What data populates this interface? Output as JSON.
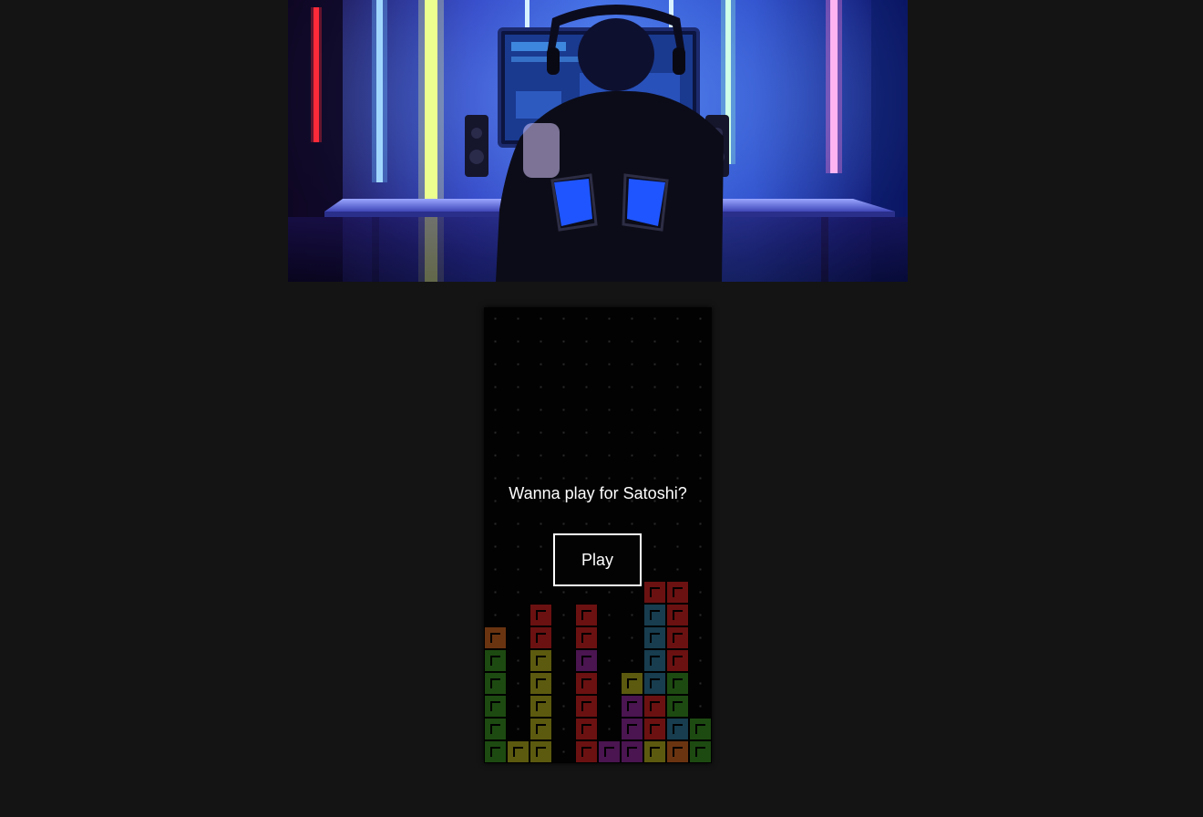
{
  "hero": {
    "image": "gamer-desk-neon-room"
  },
  "board": {
    "columns": 10,
    "rows": 20,
    "dot_color": "#2a2a2a",
    "background": "#020202",
    "stack": [
      {
        "col": 7,
        "row": 12,
        "color": "#6b1111"
      },
      {
        "col": 8,
        "row": 12,
        "color": "#6b1111"
      },
      {
        "col": 2,
        "row": 13,
        "color": "#6b1111"
      },
      {
        "col": 4,
        "row": 13,
        "color": "#6b1111"
      },
      {
        "col": 7,
        "row": 13,
        "color": "#173d4f"
      },
      {
        "col": 8,
        "row": 13,
        "color": "#6b1111"
      },
      {
        "col": 0,
        "row": 14,
        "color": "#6b3411"
      },
      {
        "col": 2,
        "row": 14,
        "color": "#6b1111"
      },
      {
        "col": 4,
        "row": 14,
        "color": "#6b1111"
      },
      {
        "col": 7,
        "row": 14,
        "color": "#173d4f"
      },
      {
        "col": 8,
        "row": 14,
        "color": "#6b1111"
      },
      {
        "col": 0,
        "row": 15,
        "color": "#1d4a11"
      },
      {
        "col": 2,
        "row": 15,
        "color": "#5c5a0f"
      },
      {
        "col": 4,
        "row": 15,
        "color": "#4a1550"
      },
      {
        "col": 7,
        "row": 15,
        "color": "#173d4f"
      },
      {
        "col": 8,
        "row": 15,
        "color": "#6b1111"
      },
      {
        "col": 0,
        "row": 16,
        "color": "#1d4a11"
      },
      {
        "col": 2,
        "row": 16,
        "color": "#5c5a0f"
      },
      {
        "col": 4,
        "row": 16,
        "color": "#6b1111"
      },
      {
        "col": 6,
        "row": 16,
        "color": "#5c5a0f"
      },
      {
        "col": 7,
        "row": 16,
        "color": "#173d4f"
      },
      {
        "col": 8,
        "row": 16,
        "color": "#1d4a11"
      },
      {
        "col": 0,
        "row": 17,
        "color": "#1d4a11"
      },
      {
        "col": 2,
        "row": 17,
        "color": "#5c5a0f"
      },
      {
        "col": 4,
        "row": 17,
        "color": "#6b1111"
      },
      {
        "col": 6,
        "row": 17,
        "color": "#4a1550"
      },
      {
        "col": 7,
        "row": 17,
        "color": "#6b1111"
      },
      {
        "col": 8,
        "row": 17,
        "color": "#1d4a11"
      },
      {
        "col": 0,
        "row": 18,
        "color": "#1d4a11"
      },
      {
        "col": 2,
        "row": 18,
        "color": "#5c5a0f"
      },
      {
        "col": 4,
        "row": 18,
        "color": "#6b1111"
      },
      {
        "col": 6,
        "row": 18,
        "color": "#4a1550"
      },
      {
        "col": 7,
        "row": 18,
        "color": "#6b1111"
      },
      {
        "col": 8,
        "row": 18,
        "color": "#173d4f"
      },
      {
        "col": 9,
        "row": 18,
        "color": "#1d4a11"
      },
      {
        "col": 0,
        "row": 19,
        "color": "#1d4a11"
      },
      {
        "col": 1,
        "row": 19,
        "color": "#5c5a0f"
      },
      {
        "col": 2,
        "row": 19,
        "color": "#5c5a0f"
      },
      {
        "col": 4,
        "row": 19,
        "color": "#6b1111"
      },
      {
        "col": 5,
        "row": 19,
        "color": "#4a1550"
      },
      {
        "col": 6,
        "row": 19,
        "color": "#4a1550"
      },
      {
        "col": 7,
        "row": 19,
        "color": "#5c5a0f"
      },
      {
        "col": 8,
        "row": 19,
        "color": "#6b3411"
      },
      {
        "col": 9,
        "row": 19,
        "color": "#1d4a11"
      }
    ]
  },
  "overlay": {
    "prompt": "Wanna play for Satoshi?",
    "play_label": "Play"
  }
}
